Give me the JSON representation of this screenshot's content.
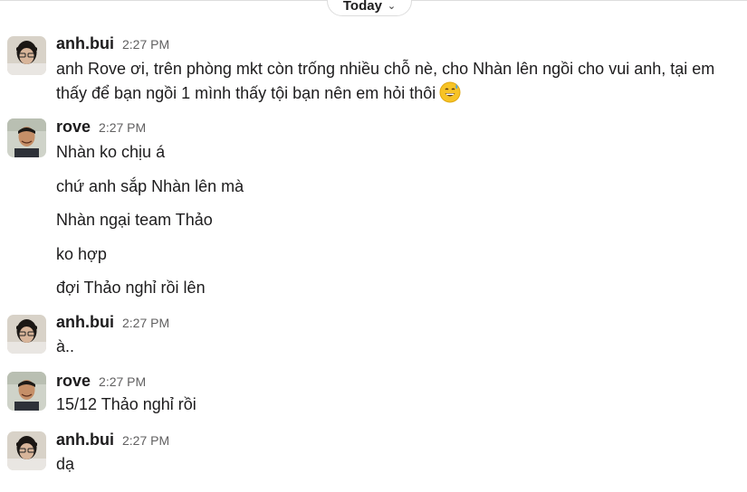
{
  "day_divider": {
    "label": "Today",
    "icon": "chevron-down-icon"
  },
  "messages": [
    {
      "user": "anh.bui",
      "time": "2:27 PM",
      "lines": [
        "anh Rove ơi, trên phòng mkt còn trống nhiều chỗ nè, cho Nhàn lên ngồi cho vui anh, tại em",
        "thấy để bạn ngồi 1 mình thấy tội bạn nên em hỏi thôi"
      ],
      "emoji": "grinning-sweat-emoji"
    },
    {
      "user": "rove",
      "time": "2:27 PM",
      "lines": [
        "Nhàn ko chịu á",
        "chứ anh sắp Nhàn lên mà",
        "Nhàn ngại team Thảo",
        "ko hợp",
        "đợi Thảo nghỉ rồi lên"
      ]
    },
    {
      "user": "anh.bui",
      "time": "2:27 PM",
      "lines": [
        "à.."
      ]
    },
    {
      "user": "rove",
      "time": "2:27 PM",
      "lines": [
        "15/12 Thảo nghỉ rồi"
      ]
    },
    {
      "user": "anh.bui",
      "time": "2:27 PM",
      "lines": [
        "dạ"
      ]
    }
  ]
}
